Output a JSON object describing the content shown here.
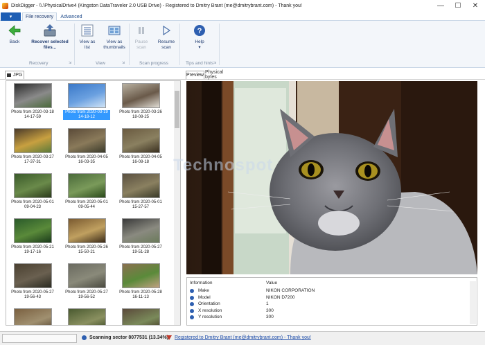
{
  "window": {
    "title": "DiskDigger - \\\\.\\PhysicalDrive4 (Kingston DataTraveler 2.0 USB Drive) - Registered to Dmitry Brant (me@dmitrybrant.com) - Thank you!",
    "minimize": "—",
    "maximize": "☐",
    "close": "✕"
  },
  "ribbon_tabs": {
    "file_tab": "▾",
    "tabs": [
      "File recovery",
      "Advanced"
    ]
  },
  "ribbon": {
    "back": "Back",
    "recover_line1": "Recover selected",
    "recover_line2": "files...",
    "view_list_line1": "View as",
    "view_list_line2": "list",
    "view_thumbs_line1": "View as",
    "view_thumbs_line2": "thumbnails",
    "pause_line1": "Pause",
    "pause_line2": "scan",
    "resume_line1": "Resume",
    "resume_line2": "scan",
    "help": "Help",
    "help_arrow": "▾",
    "groups": [
      "Recovery",
      "View",
      "Scan progress",
      "Tips and hints"
    ],
    "launcher": "⇲"
  },
  "left_tab": "JPG",
  "right_tabs": [
    "Preview",
    "Physical bytes"
  ],
  "thumbnails": [
    {
      "line1": "Photo from 2020-03-18",
      "line2": "14-17-59"
    },
    {
      "line1": "Photo from 2020-03-19",
      "line2": "14-18-12"
    },
    {
      "line1": "Photo from 2020-03-26",
      "line2": "18-08-25"
    },
    {
      "line1": "Photo from 2020-03-27",
      "line2": "17-37-31"
    },
    {
      "line1": "Photo from 2020-04-05",
      "line2": "16-03-35"
    },
    {
      "line1": "Photo from 2020-04-05",
      "line2": "16-08-18"
    },
    {
      "line1": "Photo from 2020-05-01",
      "line2": "09-04-23"
    },
    {
      "line1": "Photo from 2020-05-01",
      "line2": "09-05-44"
    },
    {
      "line1": "Photo from 2020-05-01",
      "line2": "15-27-57"
    },
    {
      "line1": "Photo from 2020-05-21",
      "line2": "19-17-16"
    },
    {
      "line1": "Photo from 2020-05-26",
      "line2": "15-50-21"
    },
    {
      "line1": "Photo from 2020-05-27",
      "line2": "19-51-28"
    },
    {
      "line1": "Photo from 2020-05-27",
      "line2": "19-56-43"
    },
    {
      "line1": "Photo from 2020-05-27",
      "line2": "19-56-52"
    },
    {
      "line1": "Photo from 2020-05-28",
      "line2": "16-11-13"
    },
    {
      "line1": "",
      "line2": ""
    },
    {
      "line1": "",
      "line2": ""
    },
    {
      "line1": "",
      "line2": ""
    }
  ],
  "selected_index": 1,
  "watermark": "Technospot",
  "info": {
    "col_info": "Information",
    "col_value": "Value",
    "rows": [
      {
        "key": "Make",
        "value": "NIKON CORPORATION"
      },
      {
        "key": "Model",
        "value": "NIKON D7200"
      },
      {
        "key": "Orientation",
        "value": "1"
      },
      {
        "key": "X resolution",
        "value": "300"
      },
      {
        "key": "Y resolution",
        "value": "300"
      }
    ]
  },
  "status": {
    "scanning": "Scanning sector 8077531 (13.34%)",
    "registered": "Registered to Dmitry Brant (me@dmitrybrant.com) - Thank you!"
  },
  "colors": {
    "accent": "#1e5eb4",
    "selection": "#3399ff",
    "ribbon_bg": "#f3f6fa"
  }
}
